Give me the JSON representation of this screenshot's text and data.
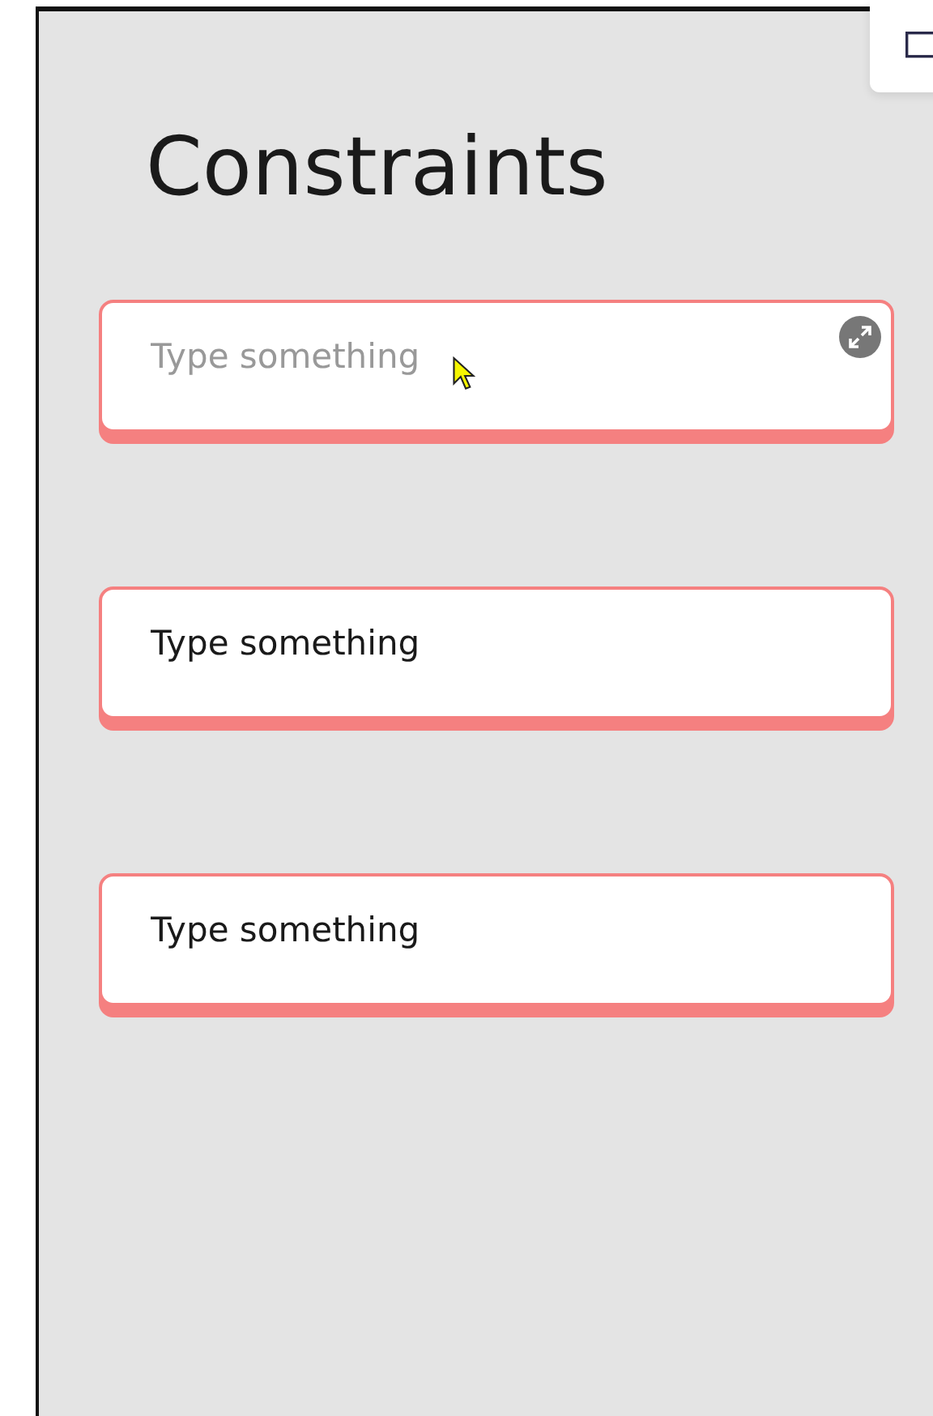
{
  "title": "Constraints",
  "fields": [
    {
      "placeholder": "Type something",
      "expandable": true
    },
    {
      "value": "Type something",
      "expandable": false
    },
    {
      "value": "Type something",
      "expandable": false
    }
  ]
}
